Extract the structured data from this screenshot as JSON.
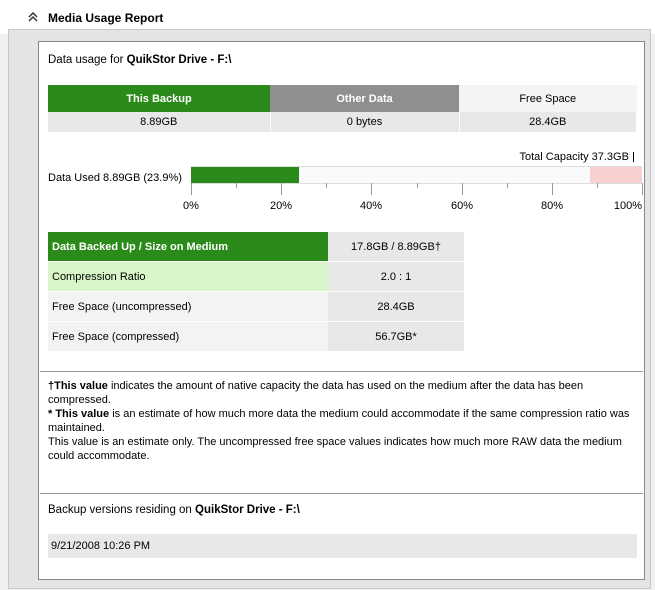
{
  "header": {
    "title": "Media Usage Report",
    "collapse_icon": "double-chevron-up-icon"
  },
  "usage": {
    "title_prefix": "Data usage for ",
    "drive": "QuikStor Drive - F:\\",
    "columns": [
      "This Backup",
      "Other Data",
      "Free Space"
    ],
    "values": [
      "8.89GB",
      "0 bytes",
      "28.4GB"
    ],
    "colors": {
      "this_backup": "#2b8b1a",
      "other_data": "#8f8f8f",
      "free_space": "#f8d0d0"
    }
  },
  "capacity": {
    "total_label": "Total Capacity 37.3GB",
    "used_label": "Data Used 8.89GB (23.9%)",
    "used_fraction": 0.239,
    "free_fraction": 0.115,
    "ticks": [
      "0%",
      "20%",
      "40%",
      "60%",
      "80%",
      "100%"
    ]
  },
  "details": [
    {
      "label": "Data Backed Up / Size on Medium",
      "value": "17.8GB / 8.89GB†"
    },
    {
      "label": "Compression Ratio",
      "value": "2.0 : 1"
    },
    {
      "label": "Free Space (uncompressed)",
      "value": "28.4GB"
    },
    {
      "label": "Free Space (compressed)",
      "value": "56.7GB*"
    }
  ],
  "notes": {
    "n1_bold": "†This value",
    "n1_text": " indicates the amount of native capacity the data has used on the medium after the data has been compressed.",
    "n2_bold": "* This value",
    "n2_text": " is an estimate of how much more data the medium could accommodate if the same compression ratio was maintained.",
    "n3_text": "This value is an estimate only. The uncompressed free space values indicates how much more RAW data the medium could accommodate."
  },
  "versions": {
    "title_prefix": "Backup versions residing on ",
    "drive": "QuikStor Drive - F:\\",
    "items": [
      "9/21/2008 10:26 PM"
    ]
  }
}
